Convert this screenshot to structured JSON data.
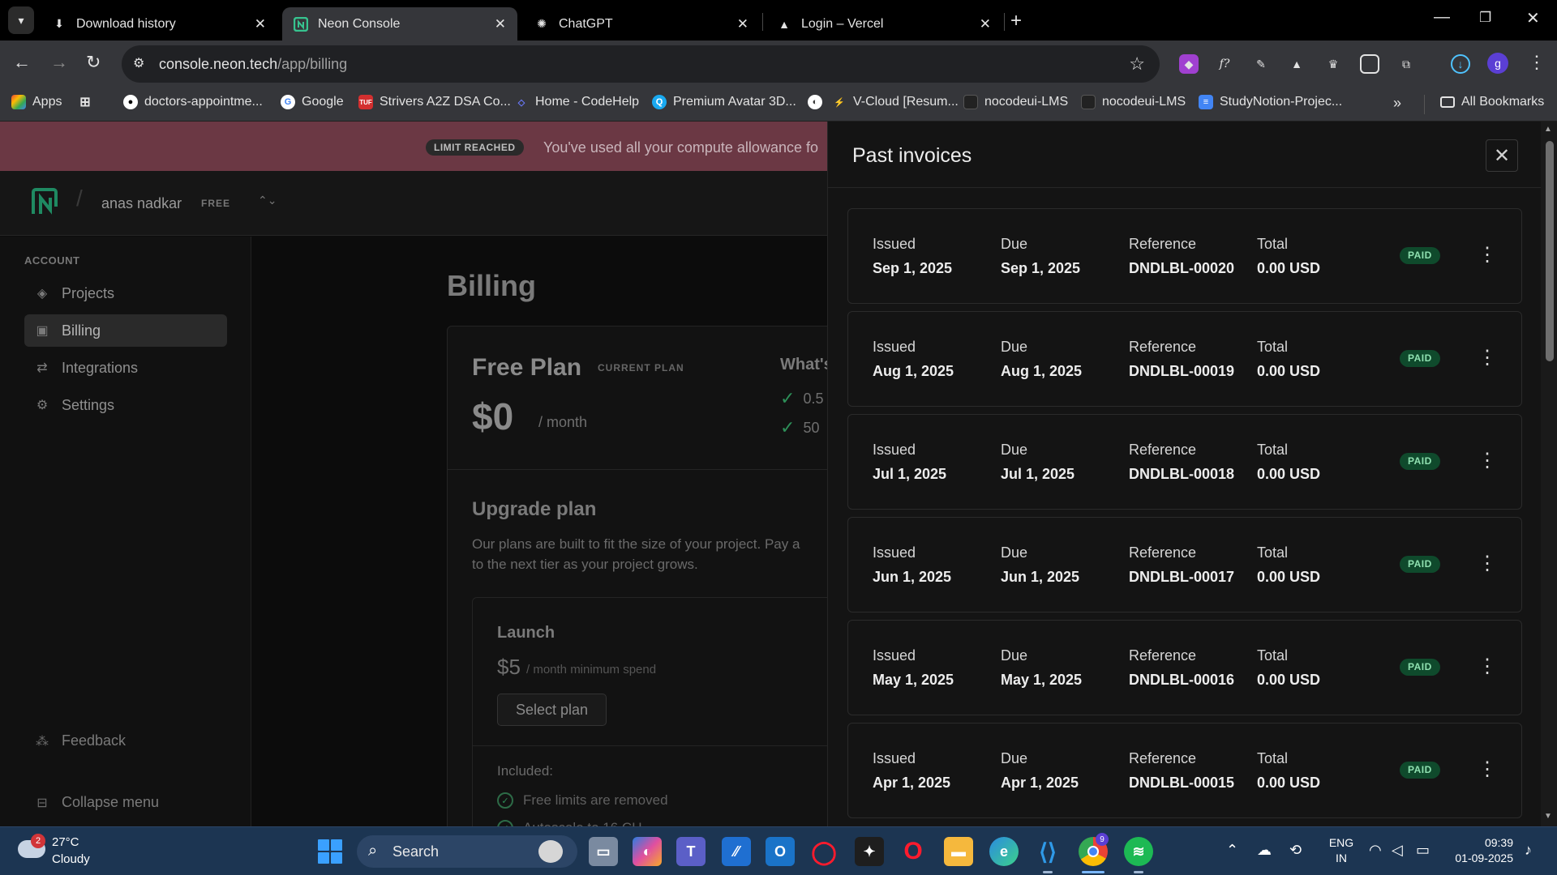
{
  "browser": {
    "tabs": [
      {
        "title": "Download history",
        "icon": "download-icon"
      },
      {
        "title": "Neon Console",
        "icon": "neon-logo-icon"
      },
      {
        "title": "ChatGPT",
        "icon": "openai-icon"
      },
      {
        "title": "Login – Vercel",
        "icon": "vercel-triangle-icon"
      }
    ],
    "url_host": "console.neon.tech",
    "url_path": "/app/billing",
    "profile_initial": "g",
    "bookmarks": [
      {
        "label": "Apps",
        "icon": "apps-grid-icon"
      },
      {
        "label": "",
        "icon": "grid-icon"
      },
      {
        "label": "doctors-appointme...",
        "icon": "github-icon"
      },
      {
        "label": "Google",
        "icon": "google-icon"
      },
      {
        "label": "Strivers A2Z DSA Co...",
        "icon": "tuf-icon"
      },
      {
        "label": "Home - CodeHelp",
        "icon": "codehelp-icon"
      },
      {
        "label": "Premium Avatar 3D...",
        "icon": "avatar-site-icon"
      },
      {
        "label": "",
        "icon": "globe-icon"
      },
      {
        "label": "V-Cloud [Resum...",
        "icon": "vcloud-icon"
      },
      {
        "label": "nocodeui-LMS",
        "icon": "nocodeui-icon"
      },
      {
        "label": "nocodeui-LMS",
        "icon": "nocodeui-icon"
      },
      {
        "label": "StudyNotion-Projec...",
        "icon": "docs-icon"
      }
    ],
    "all_bookmarks": "All Bookmarks"
  },
  "banner": {
    "badge": "LIMIT REACHED",
    "text": "You've used all your compute allowance fo"
  },
  "header": {
    "user": "anas nadkar",
    "plan_tag": "FREE"
  },
  "sidebar": {
    "heading": "ACCOUNT",
    "items": [
      {
        "label": "Projects",
        "icon": "projects-icon"
      },
      {
        "label": "Billing",
        "icon": "billing-icon"
      },
      {
        "label": "Integrations",
        "icon": "integrations-icon"
      },
      {
        "label": "Settings",
        "icon": "gear-icon"
      }
    ],
    "feedback": "Feedback",
    "collapse": "Collapse menu"
  },
  "billing": {
    "title": "Billing",
    "plan_name": "Free Plan",
    "plan_badge": "CURRENT PLAN",
    "price": "$0",
    "per": "/ month",
    "whats_included": "What's",
    "included_items": [
      "0.5",
      "50"
    ],
    "upgrade_title": "Upgrade plan",
    "upgrade_desc_1": "Our plans are built to fit the size of your project. Pay a",
    "upgrade_desc_2": "to the next tier as your project grows.",
    "launch": {
      "name": "Launch",
      "price": "$5",
      "per": "/ month minimum spend",
      "button": "Select plan",
      "included_label": "Included:",
      "features": [
        "Free limits are removed",
        "Autoscale to 16 CU"
      ]
    }
  },
  "invoices": {
    "title": "Past invoices",
    "labels": {
      "issued": "Issued",
      "due": "Due",
      "reference": "Reference",
      "total": "Total"
    },
    "status_label": "PAID",
    "rows": [
      {
        "issued": "Sep 1, 2025",
        "due": "Sep 1, 2025",
        "reference": "DNDLBL-00020",
        "total": "0.00 USD",
        "status": "PAID"
      },
      {
        "issued": "Aug 1, 2025",
        "due": "Aug 1, 2025",
        "reference": "DNDLBL-00019",
        "total": "0.00 USD",
        "status": "PAID"
      },
      {
        "issued": "Jul 1, 2025",
        "due": "Jul 1, 2025",
        "reference": "DNDLBL-00018",
        "total": "0.00 USD",
        "status": "PAID"
      },
      {
        "issued": "Jun 1, 2025",
        "due": "Jun 1, 2025",
        "reference": "DNDLBL-00017",
        "total": "0.00 USD",
        "status": "PAID"
      },
      {
        "issued": "May 1, 2025",
        "due": "May 1, 2025",
        "reference": "DNDLBL-00016",
        "total": "0.00 USD",
        "status": "PAID"
      },
      {
        "issued": "Apr 1, 2025",
        "due": "Apr 1, 2025",
        "reference": "DNDLBL-00015",
        "total": "0.00 USD",
        "status": "PAID"
      }
    ]
  },
  "taskbar": {
    "weather_temp": "27°C",
    "weather_desc": "Cloudy",
    "weather_badge": "2",
    "search_placeholder": "Search",
    "chrome_badge": "9",
    "lang_1": "ENG",
    "lang_2": "IN",
    "time": "09:39",
    "date": "01-09-2025"
  },
  "colors": {
    "accent_green": "#0f4a2c",
    "paid_text": "#8fe0b0",
    "banner": "#6b3844",
    "neon_brand": "#37c38f"
  }
}
